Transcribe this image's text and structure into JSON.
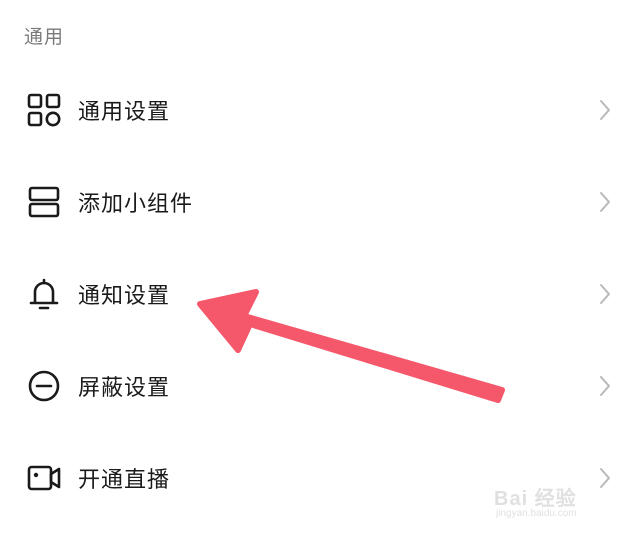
{
  "section": {
    "title": "通用"
  },
  "menu": {
    "items": [
      {
        "label": "通用设置",
        "icon": "grid-icon"
      },
      {
        "label": "添加小组件",
        "icon": "widget-icon"
      },
      {
        "label": "通知设置",
        "icon": "bell-icon"
      },
      {
        "label": "屏蔽设置",
        "icon": "block-icon"
      },
      {
        "label": "开通直播",
        "icon": "video-camera-icon"
      }
    ]
  },
  "annotation": {
    "color": "#f5576b",
    "points_to": "通知设置"
  },
  "watermark": {
    "brand": "Bai",
    "brand_cn": "经验",
    "url": "jingyan.baidu.com"
  },
  "colors": {
    "text_primary": "#1a1a1a",
    "text_secondary": "#7a7a7a",
    "chevron": "#b8b8b8",
    "background": "#ffffff"
  }
}
